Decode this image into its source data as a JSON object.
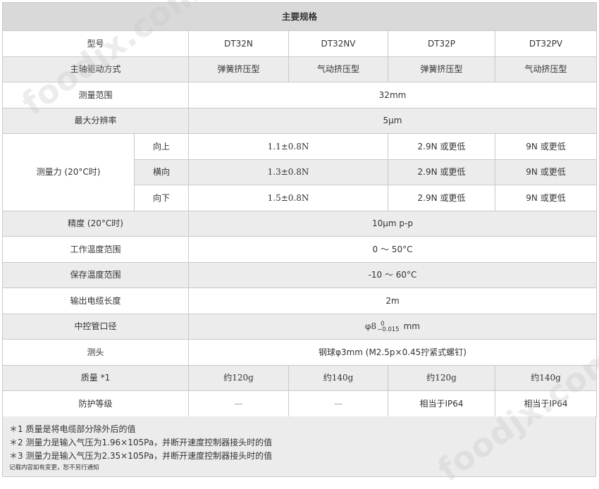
{
  "table": {
    "title": "主要规格",
    "model_label": "型号",
    "models": [
      "DT32N",
      "DT32NV",
      "DT32P",
      "DT32PV"
    ],
    "drive": {
      "label": "主轴驱动方式",
      "values": [
        "弹簧挤压型",
        "气动挤压型",
        "弹簧挤压型",
        "气动挤压型"
      ]
    },
    "range": {
      "label": "测量范围",
      "value": "32mm"
    },
    "resolution": {
      "label": "最大分辨率",
      "value": "5μm"
    },
    "force": {
      "label": "测量力 (20°C时)",
      "rows": [
        {
          "dir": "向上",
          "np": "1.1±0.8N",
          "p": "2.9N 或更低",
          "pv": "9N 或更低"
        },
        {
          "dir": "横向",
          "np": "1.3±0.8N",
          "p": "2.9N 或更低",
          "pv": "9N 或更低"
        },
        {
          "dir": "向下",
          "np": "1.5±0.8N",
          "p": "2.9N 或更低",
          "pv": "9N 或更低"
        }
      ]
    },
    "accuracy": {
      "label": "精度 (20°C时)",
      "value": "10μm p-p"
    },
    "work_temp": {
      "label": "工作温度范围",
      "value": "0 ～ 50°C"
    },
    "store_temp": {
      "label": "保存温度范围",
      "value": "-10 ～ 60°C"
    },
    "cable": {
      "label": "输出电缆长度",
      "value": "2m"
    },
    "stem": {
      "label": "中控管口径",
      "prefix": "φ8",
      "tol_upper": "0",
      "tol_lower": "−0.015",
      "unit": "mm"
    },
    "probe": {
      "label": "测头",
      "value": "钢球φ3mm (M2.5p×0.45拧紧式螺钉)"
    },
    "mass": {
      "label": "质量 *1",
      "values": [
        "约120g",
        "约140g",
        "约120g",
        "约140g"
      ]
    },
    "protection": {
      "label": "防护等级",
      "values": [
        "—",
        "—",
        "相当于IP64",
        "相当于IP64"
      ]
    }
  },
  "notes": {
    "n1": "＊1 质量是将电缆部分除外后的值",
    "n2": "＊2 测量力是输入气压为1.96×105Pa，并断开速度控制器接头时的值",
    "n3": "＊3 测量力是输入气压为2.35×105Pa，并断开速度控制器接头时的值",
    "small": "记载内容如有变更，恕不另行通知"
  },
  "watermark": "foodjx.com"
}
